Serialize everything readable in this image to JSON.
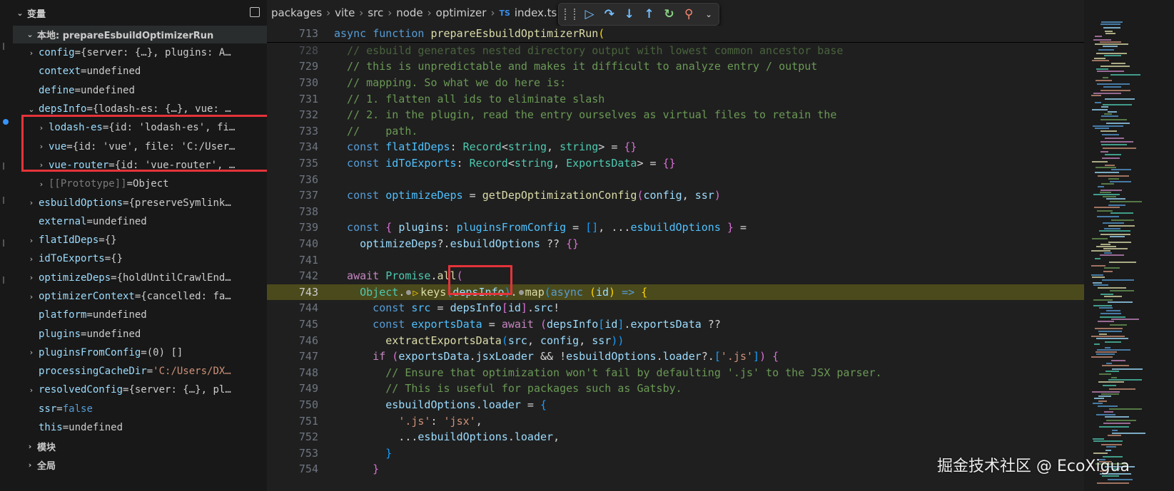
{
  "panel": {
    "title": "变量",
    "scope_local": "本地: prepareEsbuildOptimizerRun",
    "variables": [
      {
        "name": "config",
        "value": "{server: {…}, plugins: A…",
        "expandable": true,
        "indent": 1,
        "kind": "plain"
      },
      {
        "name": "context",
        "value": "undefined",
        "expandable": false,
        "indent": 1,
        "kind": "plain"
      },
      {
        "name": "define",
        "value": "undefined",
        "expandable": false,
        "indent": 1,
        "kind": "plain"
      },
      {
        "name": "depsInfo",
        "value": "{lodash-es: {…}, vue: …",
        "expandable": true,
        "expanded": true,
        "indent": 1,
        "kind": "plain"
      },
      {
        "name": "lodash-es",
        "value": "{id: 'lodash-es', fi…",
        "expandable": true,
        "indent": 2,
        "kind": "plain"
      },
      {
        "name": "vue",
        "value": "{id: 'vue', file: 'C:/User…",
        "expandable": true,
        "indent": 2,
        "kind": "plain"
      },
      {
        "name": "vue-router",
        "value": "{id: 'vue-router', …",
        "expandable": true,
        "indent": 2,
        "kind": "plain"
      },
      {
        "name": "[[Prototype]]",
        "value": "Object",
        "expandable": true,
        "indent": 2,
        "kind": "proto"
      },
      {
        "name": "esbuildOptions",
        "value": "{preserveSymlink…",
        "expandable": true,
        "indent": 1,
        "kind": "plain"
      },
      {
        "name": "external",
        "value": "undefined",
        "expandable": false,
        "indent": 1,
        "kind": "plain"
      },
      {
        "name": "flatIdDeps",
        "value": "{}",
        "expandable": true,
        "indent": 1,
        "kind": "plain"
      },
      {
        "name": "idToExports",
        "value": "{}",
        "expandable": true,
        "indent": 1,
        "kind": "plain"
      },
      {
        "name": "optimizeDeps",
        "value": "{holdUntilCrawlEnd…",
        "expandable": true,
        "indent": 1,
        "kind": "plain"
      },
      {
        "name": "optimizerContext",
        "value": "{cancelled: fa…",
        "expandable": true,
        "indent": 1,
        "kind": "plain"
      },
      {
        "name": "platform",
        "value": "undefined",
        "expandable": false,
        "indent": 1,
        "kind": "plain"
      },
      {
        "name": "plugins",
        "value": "undefined",
        "expandable": false,
        "indent": 1,
        "kind": "plain"
      },
      {
        "name": "pluginsFromConfig",
        "value": "(0) []",
        "expandable": true,
        "indent": 1,
        "kind": "plain"
      },
      {
        "name": "processingCacheDir",
        "value": "'C:/Users/DX…",
        "expandable": false,
        "indent": 1,
        "kind": "str"
      },
      {
        "name": "resolvedConfig",
        "value": "{server: {…}, pl…",
        "expandable": true,
        "indent": 1,
        "kind": "plain"
      },
      {
        "name": "ssr",
        "value": "false",
        "expandable": false,
        "indent": 1,
        "kind": "kw"
      },
      {
        "name": "this",
        "value": "undefined",
        "expandable": false,
        "indent": 1,
        "kind": "plain"
      }
    ],
    "scope_module": "模块",
    "scope_global": "全局"
  },
  "breadcrumb": [
    "packages",
    "vite",
    "src",
    "node",
    "optimizer",
    "index.ts"
  ],
  "breadcrumb_file_badge": "TS",
  "debug_toolbar": [
    {
      "name": "continue-icon",
      "glyph": "▷",
      "kind": "blue"
    },
    {
      "name": "step-over-icon",
      "glyph": "↷",
      "kind": "blue"
    },
    {
      "name": "step-into-icon",
      "glyph": "↓",
      "kind": "blue"
    },
    {
      "name": "step-out-icon",
      "glyph": "↑",
      "kind": "blue"
    },
    {
      "name": "restart-icon",
      "glyph": "↻",
      "kind": "green"
    },
    {
      "name": "disconnect-icon",
      "glyph": "⚲",
      "kind": "red"
    }
  ],
  "code": {
    "sticky_line": {
      "no": "713",
      "tokens": [
        [
          "kw",
          "async "
        ],
        [
          "kw",
          "function "
        ],
        [
          "fn",
          "prepareEsbuildOptimizerRun"
        ],
        [
          "br1",
          "("
        ]
      ]
    },
    "lines": [
      {
        "no": "728",
        "half": true,
        "tokens": [
          [
            "com",
            "  // esbuild generates nested directory output with lowest common ancestor base"
          ]
        ]
      },
      {
        "no": "729",
        "tokens": [
          [
            "com",
            "  // this is unpredictable and makes it difficult to analyze entry / output"
          ]
        ]
      },
      {
        "no": "730",
        "tokens": [
          [
            "com",
            "  // mapping. So what we do here is:"
          ]
        ]
      },
      {
        "no": "731",
        "tokens": [
          [
            "com",
            "  // 1. flatten all ids to eliminate slash"
          ]
        ]
      },
      {
        "no": "732",
        "tokens": [
          [
            "com",
            "  // 2. in the plugin, read the entry ourselves as virtual files to retain the"
          ]
        ]
      },
      {
        "no": "733",
        "tokens": [
          [
            "com",
            "  //    path."
          ]
        ]
      },
      {
        "no": "734",
        "tokens": [
          [
            "kw",
            "  const "
          ],
          [
            "const",
            "flatIdDeps"
          ],
          [
            "op",
            ": "
          ],
          [
            "type",
            "Record"
          ],
          [
            "op",
            "<"
          ],
          [
            "type",
            "string"
          ],
          [
            "op",
            ", "
          ],
          [
            "type",
            "string"
          ],
          [
            "op",
            "> = "
          ],
          [
            "br2",
            "{}"
          ]
        ]
      },
      {
        "no": "735",
        "tokens": [
          [
            "kw",
            "  const "
          ],
          [
            "const",
            "idToExports"
          ],
          [
            "op",
            ": "
          ],
          [
            "type",
            "Record"
          ],
          [
            "op",
            "<"
          ],
          [
            "type",
            "string"
          ],
          [
            "op",
            ", "
          ],
          [
            "type",
            "ExportsData"
          ],
          [
            "op",
            "> = "
          ],
          [
            "br2",
            "{}"
          ]
        ]
      },
      {
        "no": "736",
        "tokens": []
      },
      {
        "no": "737",
        "tokens": [
          [
            "kw",
            "  const "
          ],
          [
            "const",
            "optimizeDeps"
          ],
          [
            "op",
            " = "
          ],
          [
            "fn",
            "getDepOptimizationConfig"
          ],
          [
            "br2",
            "("
          ],
          [
            "var",
            "config"
          ],
          [
            "op",
            ", "
          ],
          [
            "var",
            "ssr"
          ],
          [
            "br2",
            ")"
          ]
        ]
      },
      {
        "no": "738",
        "tokens": []
      },
      {
        "no": "739",
        "tokens": [
          [
            "kw",
            "  const "
          ],
          [
            "br2",
            "{ "
          ],
          [
            "var",
            "plugins"
          ],
          [
            "op",
            ": "
          ],
          [
            "const",
            "pluginsFromConfig"
          ],
          [
            "op",
            " = "
          ],
          [
            "br3",
            "[]"
          ],
          [
            "op",
            ", ..."
          ],
          [
            "const",
            "esbuildOptions"
          ],
          [
            "br2",
            " }"
          ],
          [
            "op",
            " ="
          ]
        ]
      },
      {
        "no": "740",
        "tokens": [
          [
            "op",
            "    "
          ],
          [
            "var",
            "optimizeDeps"
          ],
          [
            "op",
            "?."
          ],
          [
            "var",
            "esbuildOptions"
          ],
          [
            "op",
            " ?? "
          ],
          [
            "br2",
            "{}"
          ]
        ]
      },
      {
        "no": "741",
        "tokens": []
      },
      {
        "no": "742",
        "tokens": [
          [
            "ctl",
            "  await "
          ],
          [
            "type",
            "Promise"
          ],
          [
            "op",
            "."
          ],
          [
            "fn",
            "all"
          ],
          [
            "br2",
            "("
          ]
        ]
      },
      {
        "no": "743",
        "current": true,
        "breakpoint": true,
        "tokens": [
          [
            "op",
            "    "
          ],
          [
            "type",
            "Object"
          ],
          [
            "op",
            "."
          ],
          [
            "inlinebp",
            ""
          ],
          [
            "ipoint",
            ""
          ],
          [
            "fn",
            "keys"
          ],
          [
            "br3",
            "("
          ],
          [
            "var",
            "depsInfo"
          ],
          [
            "br3",
            ")"
          ],
          [
            "op",
            "."
          ],
          [
            "inlinebp",
            ""
          ],
          [
            "fn",
            "map"
          ],
          [
            "br3",
            "("
          ],
          [
            "kw",
            "async "
          ],
          [
            "br1",
            "("
          ],
          [
            "var",
            "id"
          ],
          [
            "br1",
            ")"
          ],
          [
            "kw",
            " => "
          ],
          [
            "br1",
            "{"
          ]
        ]
      },
      {
        "no": "744",
        "tokens": [
          [
            "kw",
            "      const "
          ],
          [
            "const",
            "src"
          ],
          [
            "op",
            " = "
          ],
          [
            "var",
            "depsInfo"
          ],
          [
            "br2",
            "["
          ],
          [
            "var",
            "id"
          ],
          [
            "br2",
            "]"
          ],
          [
            "op",
            "."
          ],
          [
            "var",
            "src"
          ],
          [
            "op",
            "!"
          ]
        ]
      },
      {
        "no": "745",
        "tokens": [
          [
            "kw",
            "      const "
          ],
          [
            "const",
            "exportsData"
          ],
          [
            "op",
            " = "
          ],
          [
            "ctl",
            "await "
          ],
          [
            "br2",
            "("
          ],
          [
            "var",
            "depsInfo"
          ],
          [
            "br3",
            "["
          ],
          [
            "var",
            "id"
          ],
          [
            "br3",
            "]"
          ],
          [
            "op",
            "."
          ],
          [
            "var",
            "exportsData"
          ],
          [
            "op",
            " ??"
          ]
        ]
      },
      {
        "no": "746",
        "tokens": [
          [
            "op",
            "        "
          ],
          [
            "fn",
            "extractExportsData"
          ],
          [
            "br3",
            "("
          ],
          [
            "var",
            "src"
          ],
          [
            "op",
            ", "
          ],
          [
            "var",
            "config"
          ],
          [
            "op",
            ", "
          ],
          [
            "var",
            "ssr"
          ],
          [
            "br3",
            "))"
          ]
        ]
      },
      {
        "no": "747",
        "tokens": [
          [
            "ctl",
            "      if "
          ],
          [
            "br2",
            "("
          ],
          [
            "var",
            "exportsData"
          ],
          [
            "op",
            "."
          ],
          [
            "var",
            "jsxLoader"
          ],
          [
            "op",
            " && !"
          ],
          [
            "var",
            "esbuildOptions"
          ],
          [
            "op",
            "."
          ],
          [
            "var",
            "loader"
          ],
          [
            "op",
            "?."
          ],
          [
            "br3",
            "["
          ],
          [
            "str",
            "'.js'"
          ],
          [
            "br3",
            "]"
          ],
          [
            "br2",
            ")"
          ],
          [
            "op",
            " "
          ],
          [
            "br2",
            "{"
          ]
        ]
      },
      {
        "no": "748",
        "tokens": [
          [
            "com",
            "        // Ensure that optimization won't fail by defaulting '.js' to the JSX parser."
          ]
        ]
      },
      {
        "no": "749",
        "tokens": [
          [
            "com",
            "        // This is useful for packages such as Gatsby."
          ]
        ]
      },
      {
        "no": "750",
        "tokens": [
          [
            "op",
            "        "
          ],
          [
            "var",
            "esbuildOptions"
          ],
          [
            "op",
            "."
          ],
          [
            "var",
            "loader"
          ],
          [
            "op",
            " = "
          ],
          [
            "br3",
            "{"
          ]
        ]
      },
      {
        "no": "751",
        "tokens": [
          [
            "op",
            "          "
          ],
          [
            "str",
            "'.js'"
          ],
          [
            "op",
            ": "
          ],
          [
            "str",
            "'jsx'"
          ],
          [
            "op",
            ","
          ]
        ]
      },
      {
        "no": "752",
        "tokens": [
          [
            "op",
            "          ..."
          ],
          [
            "var",
            "esbuildOptions"
          ],
          [
            "op",
            "."
          ],
          [
            "var",
            "loader"
          ],
          [
            "op",
            ","
          ]
        ]
      },
      {
        "no": "753",
        "tokens": [
          [
            "br3",
            "        }"
          ]
        ]
      },
      {
        "no": "754",
        "tokens": [
          [
            "br2",
            "      }"
          ]
        ]
      }
    ]
  },
  "watermark": "掘金技术社区 @ EcoXigua"
}
